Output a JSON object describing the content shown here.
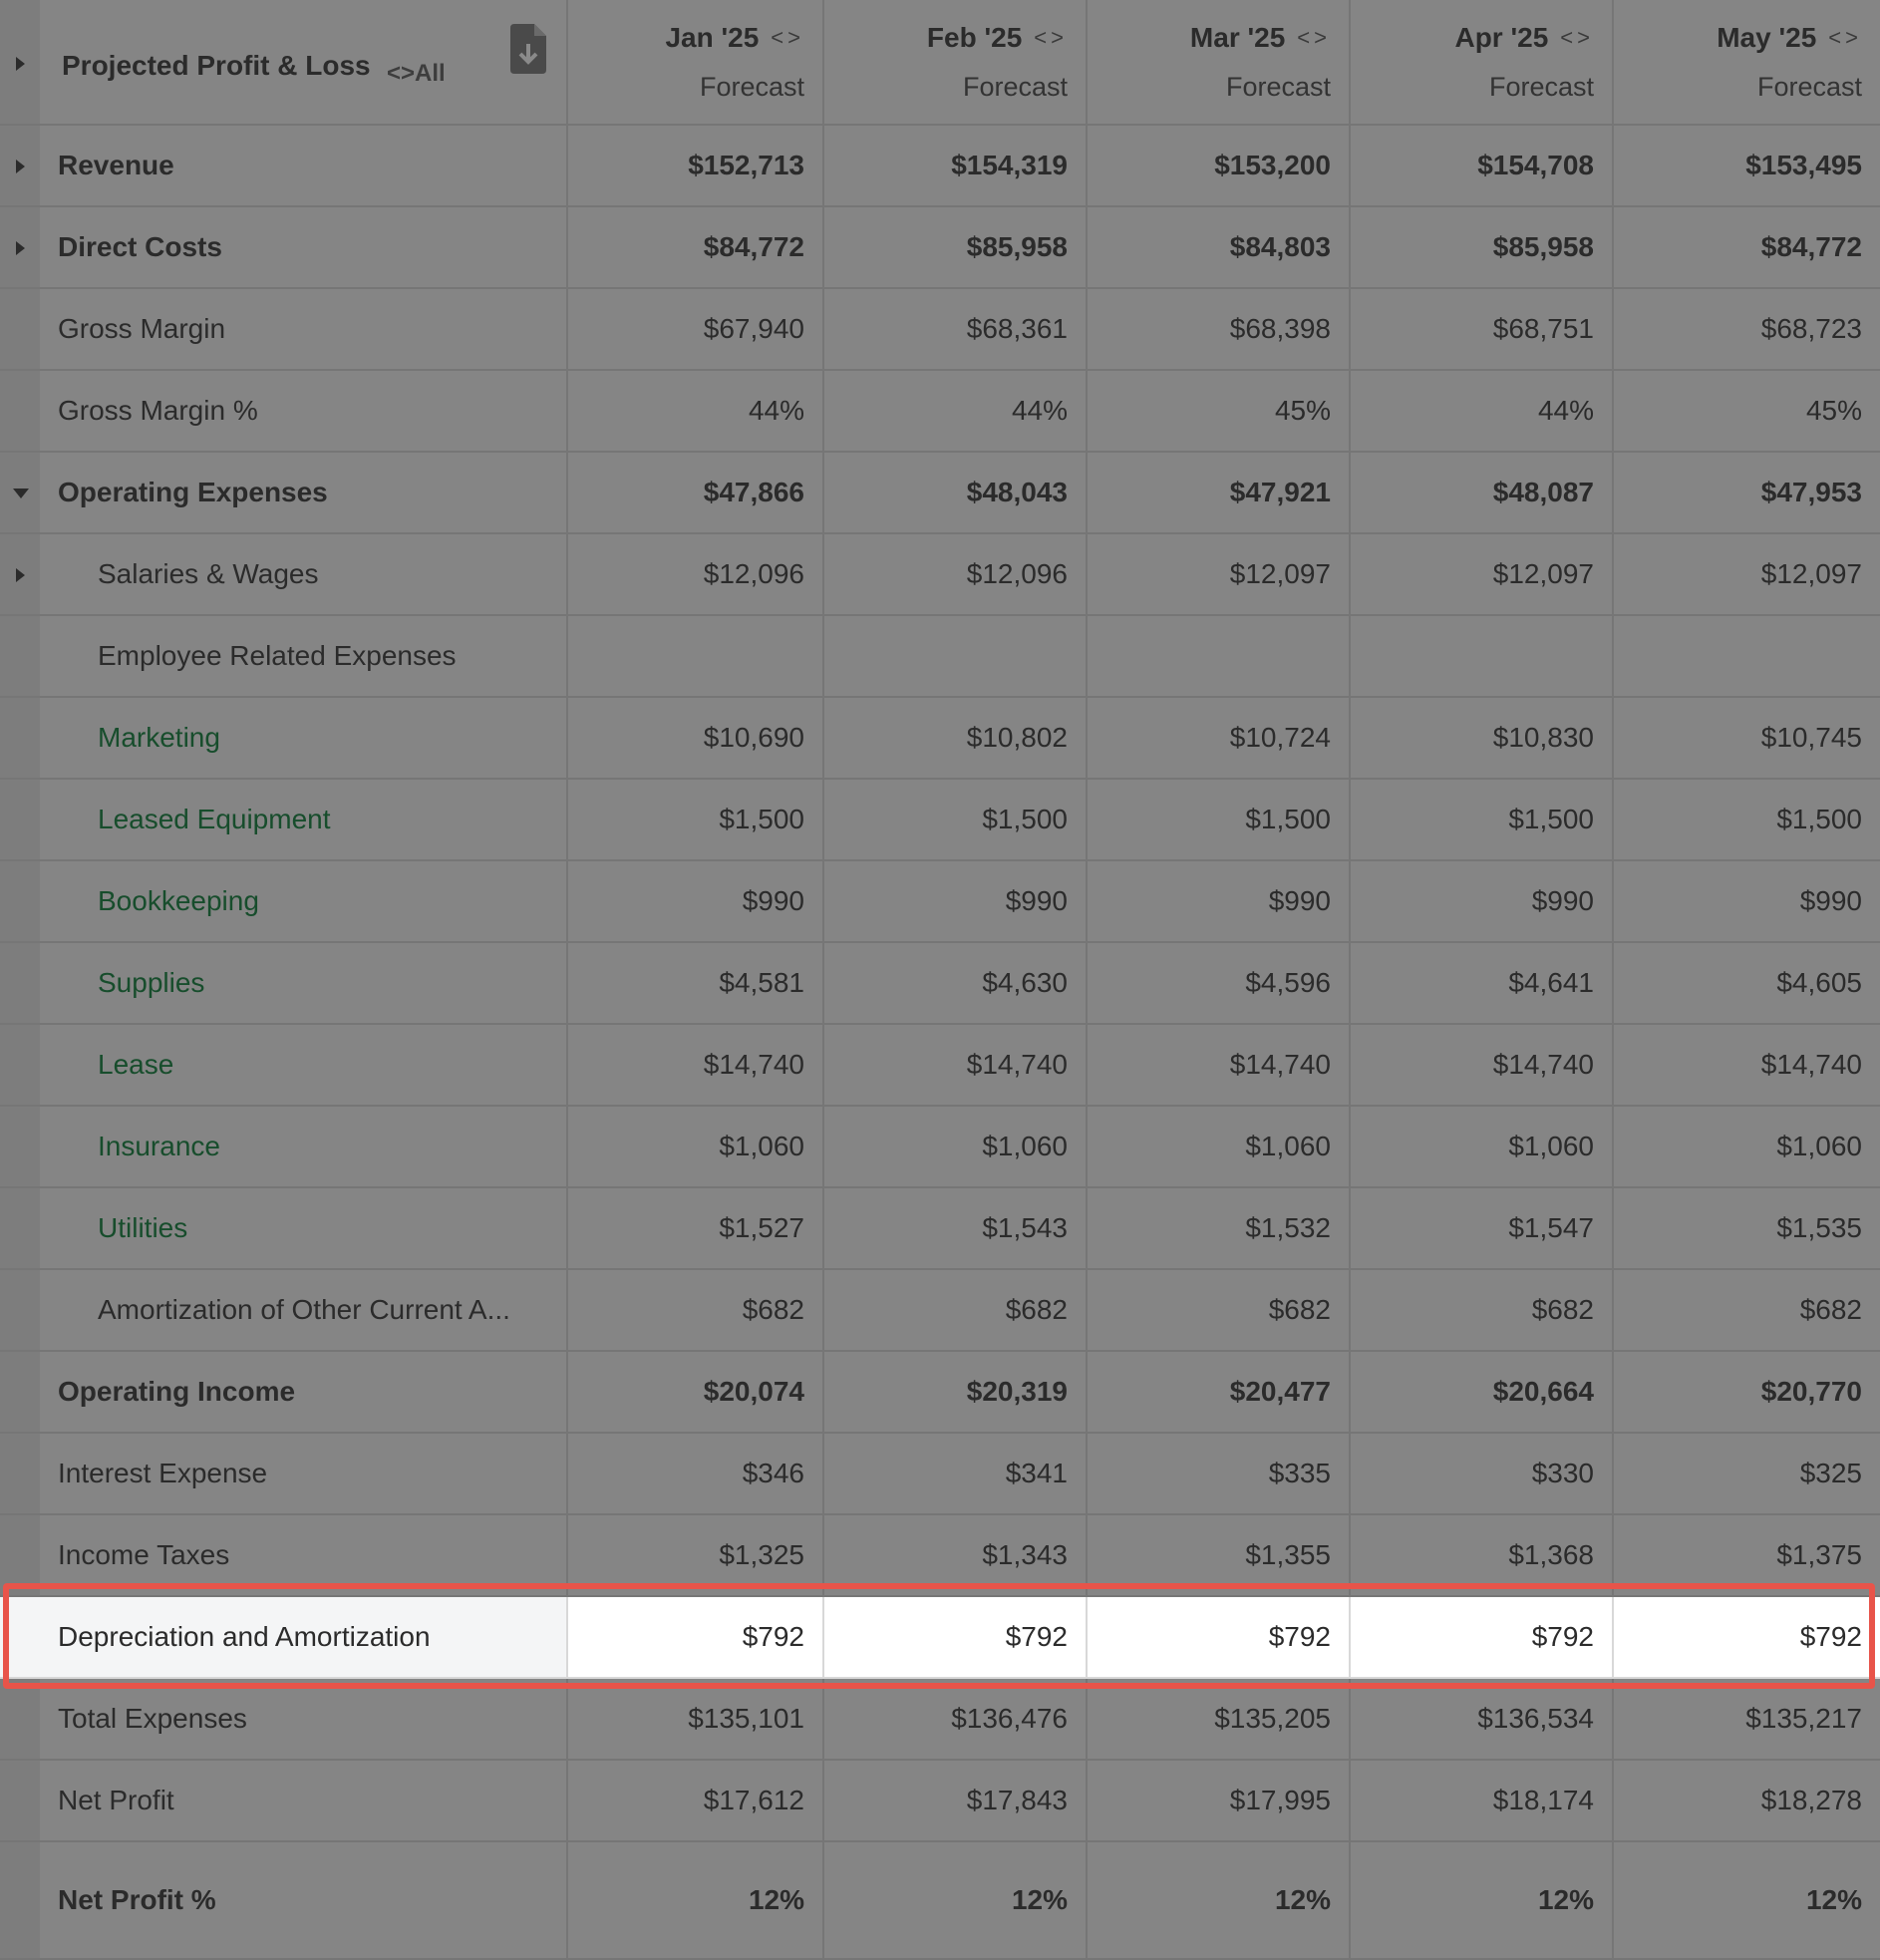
{
  "header": {
    "title": "Projected Profit & Loss",
    "all_label": "All",
    "months": [
      {
        "label": "Jan '25",
        "sub": "Forecast"
      },
      {
        "label": "Feb '25",
        "sub": "Forecast"
      },
      {
        "label": "Mar '25",
        "sub": "Forecast"
      },
      {
        "label": "Apr '25",
        "sub": "Forecast"
      },
      {
        "label": "May '25",
        "sub": "Forecast"
      }
    ]
  },
  "rows": [
    {
      "label": "Revenue",
      "values": [
        "$152,713",
        "$154,319",
        "$153,200",
        "$154,708",
        "$153,495"
      ]
    },
    {
      "label": "Direct Costs",
      "values": [
        "$84,772",
        "$85,958",
        "$84,803",
        "$85,958",
        "$84,772"
      ]
    },
    {
      "label": "Gross Margin",
      "values": [
        "$67,940",
        "$68,361",
        "$68,398",
        "$68,751",
        "$68,723"
      ]
    },
    {
      "label": "Gross Margin %",
      "values": [
        "44%",
        "44%",
        "45%",
        "44%",
        "45%"
      ]
    },
    {
      "label": "Operating Expenses",
      "values": [
        "$47,866",
        "$48,043",
        "$47,921",
        "$48,087",
        "$47,953"
      ]
    },
    {
      "label": "Salaries & Wages",
      "values": [
        "$12,096",
        "$12,096",
        "$12,097",
        "$12,097",
        "$12,097"
      ]
    },
    {
      "label": "Employee Related Expenses",
      "values": [
        "",
        "",
        "",
        "",
        ""
      ]
    },
    {
      "label": "Marketing",
      "values": [
        "$10,690",
        "$10,802",
        "$10,724",
        "$10,830",
        "$10,745"
      ]
    },
    {
      "label": "Leased Equipment",
      "values": [
        "$1,500",
        "$1,500",
        "$1,500",
        "$1,500",
        "$1,500"
      ]
    },
    {
      "label": "Bookkeeping",
      "values": [
        "$990",
        "$990",
        "$990",
        "$990",
        "$990"
      ]
    },
    {
      "label": "Supplies",
      "values": [
        "$4,581",
        "$4,630",
        "$4,596",
        "$4,641",
        "$4,605"
      ]
    },
    {
      "label": "Lease",
      "values": [
        "$14,740",
        "$14,740",
        "$14,740",
        "$14,740",
        "$14,740"
      ]
    },
    {
      "label": "Insurance",
      "values": [
        "$1,060",
        "$1,060",
        "$1,060",
        "$1,060",
        "$1,060"
      ]
    },
    {
      "label": "Utilities",
      "values": [
        "$1,527",
        "$1,543",
        "$1,532",
        "$1,547",
        "$1,535"
      ]
    },
    {
      "label": "Amortization of Other Current A...",
      "values": [
        "$682",
        "$682",
        "$682",
        "$682",
        "$682"
      ]
    },
    {
      "label": "Operating Income",
      "values": [
        "$20,074",
        "$20,319",
        "$20,477",
        "$20,664",
        "$20,770"
      ]
    },
    {
      "label": "Interest Expense",
      "values": [
        "$346",
        "$341",
        "$335",
        "$330",
        "$325"
      ]
    },
    {
      "label": "Income Taxes",
      "values": [
        "$1,325",
        "$1,343",
        "$1,355",
        "$1,368",
        "$1,375"
      ]
    },
    {
      "label": "Depreciation and Amortization",
      "values": [
        "$792",
        "$792",
        "$792",
        "$792",
        "$792"
      ]
    },
    {
      "label": "Total Expenses",
      "values": [
        "$135,101",
        "$136,476",
        "$135,205",
        "$136,534",
        "$135,217"
      ]
    },
    {
      "label": "Net Profit",
      "values": [
        "$17,612",
        "$17,843",
        "$17,995",
        "$18,174",
        "$18,278"
      ]
    },
    {
      "label": "Net Profit %",
      "values": [
        "12%",
        "12%",
        "12%",
        "12%",
        "12%"
      ]
    }
  ],
  "colors": {
    "accent_green": "#174d2c",
    "highlight_border": "#e8544a"
  }
}
